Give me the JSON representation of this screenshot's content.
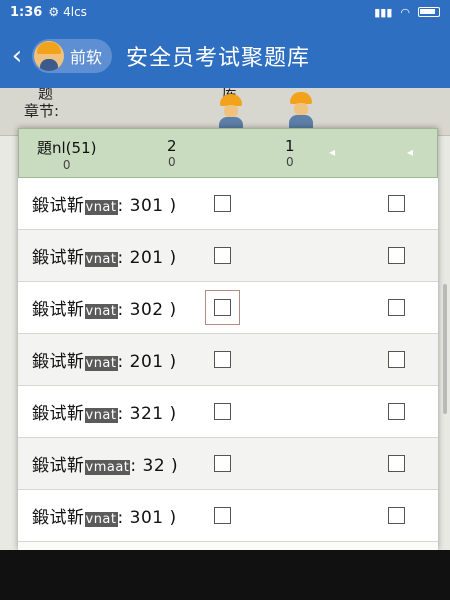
{
  "status": {
    "time": "1:36",
    "carrier": "4lcs",
    "icons": [
      "settings-icon",
      "signal-icon",
      "wifi-icon",
      "battery-icon"
    ]
  },
  "nav": {
    "back_icon": "chevron-left-icon",
    "chip_label": "前软",
    "title": "安全员考试聚题库"
  },
  "background": {
    "label_1": "题",
    "label_2": "章节:",
    "label_3": "库"
  },
  "table": {
    "header": {
      "col1": "題nl(51)",
      "col1_sub": "0",
      "col2": "2",
      "col2_sub": "0",
      "col3": "1",
      "col3_sub": "0"
    },
    "rows": [
      {
        "prefix": "鍛试靳",
        "tag": "vnat",
        "suffix": ": 301 )"
      },
      {
        "prefix": "鍛试靳",
        "tag": "vnat",
        "suffix": ": 201 )"
      },
      {
        "prefix": "鍛试靳",
        "tag": "vnat",
        "suffix": ": 302 )"
      },
      {
        "prefix": "鍛试靳",
        "tag": "vnat",
        "suffix": ": 201 )"
      },
      {
        "prefix": "鍛试靳",
        "tag": "vnat",
        "suffix": ": 321 )"
      },
      {
        "prefix": "鍛试靳",
        "tag": "vmaat",
        "suffix": ": 32 )"
      },
      {
        "prefix": "鍛试靳",
        "tag": "vnat",
        "suffix": ": 301 )"
      }
    ]
  },
  "colors": {
    "primary": "#2f6fc2",
    "header_bg": "#c9dcbf",
    "hardhat": "#f3a21b"
  }
}
